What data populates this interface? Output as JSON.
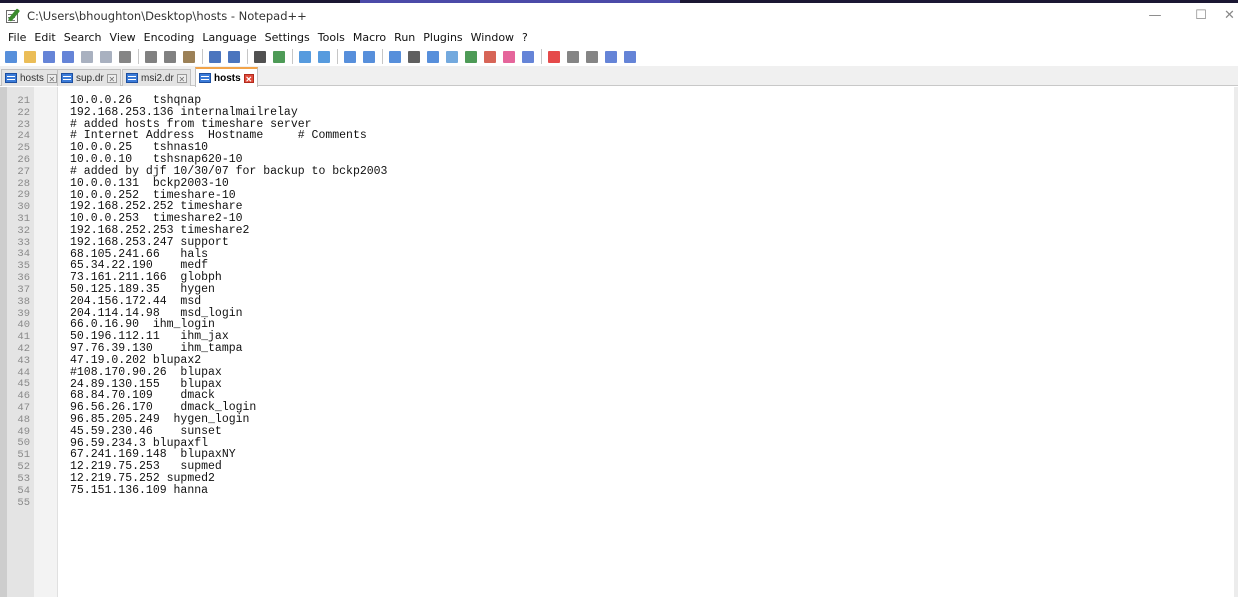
{
  "window": {
    "title": "C:\\Users\\bhoughton\\Desktop\\hosts - Notepad++",
    "controls": {
      "minimize": "—",
      "maximize": "☐",
      "close": "✕"
    }
  },
  "menu": [
    "File",
    "Edit",
    "Search",
    "View",
    "Encoding",
    "Language",
    "Settings",
    "Tools",
    "Macro",
    "Run",
    "Plugins",
    "Window",
    "?"
  ],
  "toolbar": [
    {
      "name": "new-file-icon",
      "color": "#3a7bd5"
    },
    {
      "name": "open-file-icon",
      "color": "#e7b23a"
    },
    {
      "name": "save-icon",
      "color": "#4a6ed0"
    },
    {
      "name": "save-all-icon",
      "color": "#4a6ed0"
    },
    {
      "name": "close-file-icon",
      "color": "#9aa3b5"
    },
    {
      "name": "close-all-icon",
      "color": "#9aa3b5"
    },
    {
      "name": "print-icon",
      "color": "#707070"
    },
    {
      "sep": true
    },
    {
      "name": "cut-icon",
      "color": "#6b6b6b"
    },
    {
      "name": "copy-icon",
      "color": "#6b6b6b"
    },
    {
      "name": "paste-icon",
      "color": "#8b6b3a"
    },
    {
      "sep": true
    },
    {
      "name": "undo-icon",
      "color": "#2b5db3"
    },
    {
      "name": "redo-icon",
      "color": "#2b5db3"
    },
    {
      "sep": true
    },
    {
      "name": "find-icon",
      "color": "#333333"
    },
    {
      "name": "replace-icon",
      "color": "#2f8a3a"
    },
    {
      "sep": true
    },
    {
      "name": "zoom-in-icon",
      "color": "#3a8ad8"
    },
    {
      "name": "zoom-out-icon",
      "color": "#3a8ad8"
    },
    {
      "sep": true
    },
    {
      "name": "sync-vertical-icon",
      "color": "#3a7bd5"
    },
    {
      "name": "sync-horizontal-icon",
      "color": "#3a7bd5"
    },
    {
      "sep": true
    },
    {
      "name": "word-wrap-icon",
      "color": "#3a7bd5"
    },
    {
      "name": "show-all-chars-icon",
      "color": "#444444"
    },
    {
      "name": "indent-guide-icon",
      "color": "#3a7bd5"
    },
    {
      "name": "language-icon",
      "color": "#5a9ad8"
    },
    {
      "name": "doc-map-icon",
      "color": "#2f8a3a"
    },
    {
      "name": "function-list-icon",
      "color": "#d04a3a"
    },
    {
      "name": "folder-workspace-icon",
      "color": "#e04a8a"
    },
    {
      "name": "monitor-icon",
      "color": "#4a6ed0"
    },
    {
      "sep": true
    },
    {
      "name": "record-macro-icon",
      "color": "#e02a2a"
    },
    {
      "name": "stop-macro-icon",
      "color": "#707070"
    },
    {
      "name": "play-macro-icon",
      "color": "#707070"
    },
    {
      "name": "play-multiple-icon",
      "color": "#4a6ed0"
    },
    {
      "name": "save-macro-icon",
      "color": "#4a6ed0"
    }
  ],
  "tabs": [
    {
      "label": "hosts",
      "close": "✕",
      "active": false
    },
    {
      "label": "sup.dr",
      "close": "✕",
      "active": false
    },
    {
      "label": "msi2.dr",
      "close": "✕",
      "active": false
    },
    {
      "label": "hosts",
      "close": "✕",
      "active": true
    }
  ],
  "editor": {
    "lines": [
      {
        "num": "21",
        "text": "10.0.0.26   tshqnap"
      },
      {
        "num": "22",
        "text": "192.168.253.136 internalmailrelay"
      },
      {
        "num": "23",
        "text": "# added hosts from timeshare server"
      },
      {
        "num": "24",
        "text": "# Internet Address  Hostname     # Comments"
      },
      {
        "num": "25",
        "text": "10.0.0.25   tshnas10"
      },
      {
        "num": "26",
        "text": "10.0.0.10   tshsnap620-10"
      },
      {
        "num": "27",
        "text": "# added by djf 10/30/07 for backup to bckp2003"
      },
      {
        "num": "28",
        "text": "10.0.0.131  bckp2003-10"
      },
      {
        "num": "29",
        "text": "10.0.0.252  timeshare-10"
      },
      {
        "num": "30",
        "text": "192.168.252.252 timeshare"
      },
      {
        "num": "31",
        "text": "10.0.0.253  timeshare2-10"
      },
      {
        "num": "32",
        "text": "192.168.252.253 timeshare2"
      },
      {
        "num": "33",
        "text": "192.168.253.247 support"
      },
      {
        "num": "34",
        "text": "68.105.241.66   hals"
      },
      {
        "num": "35",
        "text": "65.34.22.190    medf"
      },
      {
        "num": "36",
        "text": "73.161.211.166  globph"
      },
      {
        "num": "37",
        "text": "50.125.189.35   hygen"
      },
      {
        "num": "38",
        "text": "204.156.172.44  msd"
      },
      {
        "num": "39",
        "text": "204.114.14.98   msd_login"
      },
      {
        "num": "40",
        "text": "66.0.16.90  ihm_login"
      },
      {
        "num": "41",
        "text": "50.196.112.11   ihm_jax"
      },
      {
        "num": "42",
        "text": "97.76.39.130    ihm_tampa"
      },
      {
        "num": "43",
        "text": "47.19.0.202 blupax2"
      },
      {
        "num": "44",
        "text": "#108.170.90.26  blupax"
      },
      {
        "num": "45",
        "text": "24.89.130.155   blupax"
      },
      {
        "num": "46",
        "text": "68.84.70.109    dmack"
      },
      {
        "num": "47",
        "text": "96.56.26.170    dmack_login"
      },
      {
        "num": "48",
        "text": "96.85.205.249  hygen_login"
      },
      {
        "num": "49",
        "text": "45.59.230.46    sunset"
      },
      {
        "num": "50",
        "text": "96.59.234.3 blupaxfl"
      },
      {
        "num": "51",
        "text": "67.241.169.148  blupaxNY"
      },
      {
        "num": "52",
        "text": "12.219.75.253   supmed"
      },
      {
        "num": "53",
        "text": "12.219.75.252 supmed2"
      },
      {
        "num": "54",
        "text": "75.151.136.109 hanna"
      },
      {
        "num": "55",
        "text": ""
      }
    ]
  }
}
